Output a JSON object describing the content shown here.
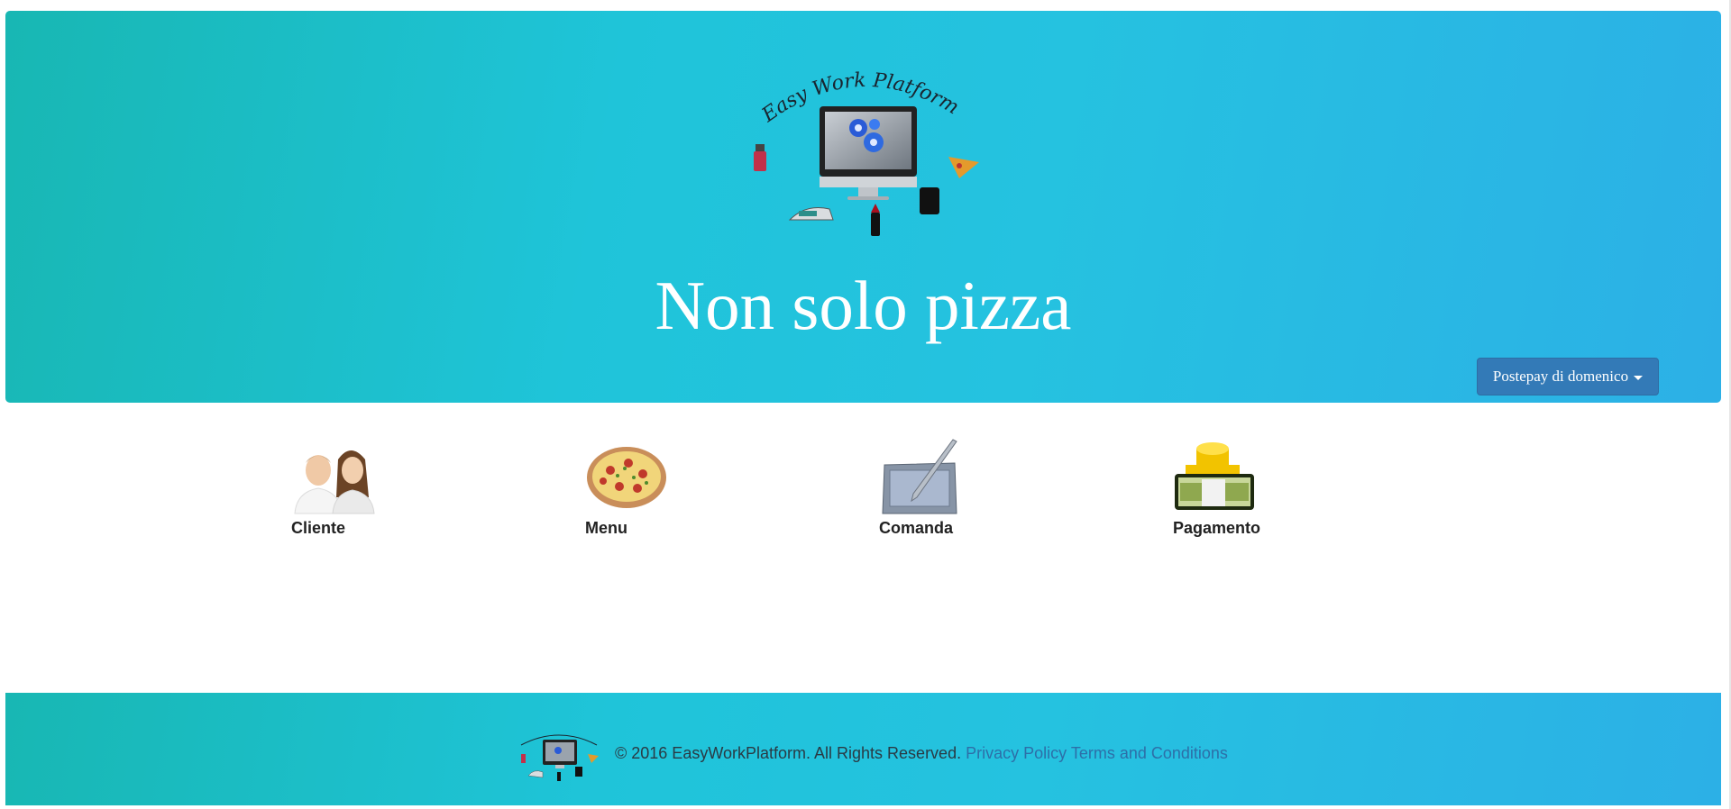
{
  "hero": {
    "title": "Non solo pizza",
    "logo_text": "Easy Work Platform",
    "account_button": "Postepay di domenico"
  },
  "tiles": [
    {
      "label": "Cliente",
      "icon": "people-icon"
    },
    {
      "label": "Menu",
      "icon": "pizza-icon"
    },
    {
      "label": "Comanda",
      "icon": "tablet-pen-icon"
    },
    {
      "label": "Pagamento",
      "icon": "money-icon"
    }
  ],
  "footer": {
    "copyright": "© 2016 EasyWorkPlatform. All Rights Reserved.",
    "privacy": "Privacy Policy",
    "terms": "Terms and Conditions"
  },
  "colors": {
    "hero_gradient_start": "#18b7b3",
    "hero_gradient_end": "#2cb0e6",
    "button_primary": "#337ab7",
    "link": "#2d6fa8"
  }
}
